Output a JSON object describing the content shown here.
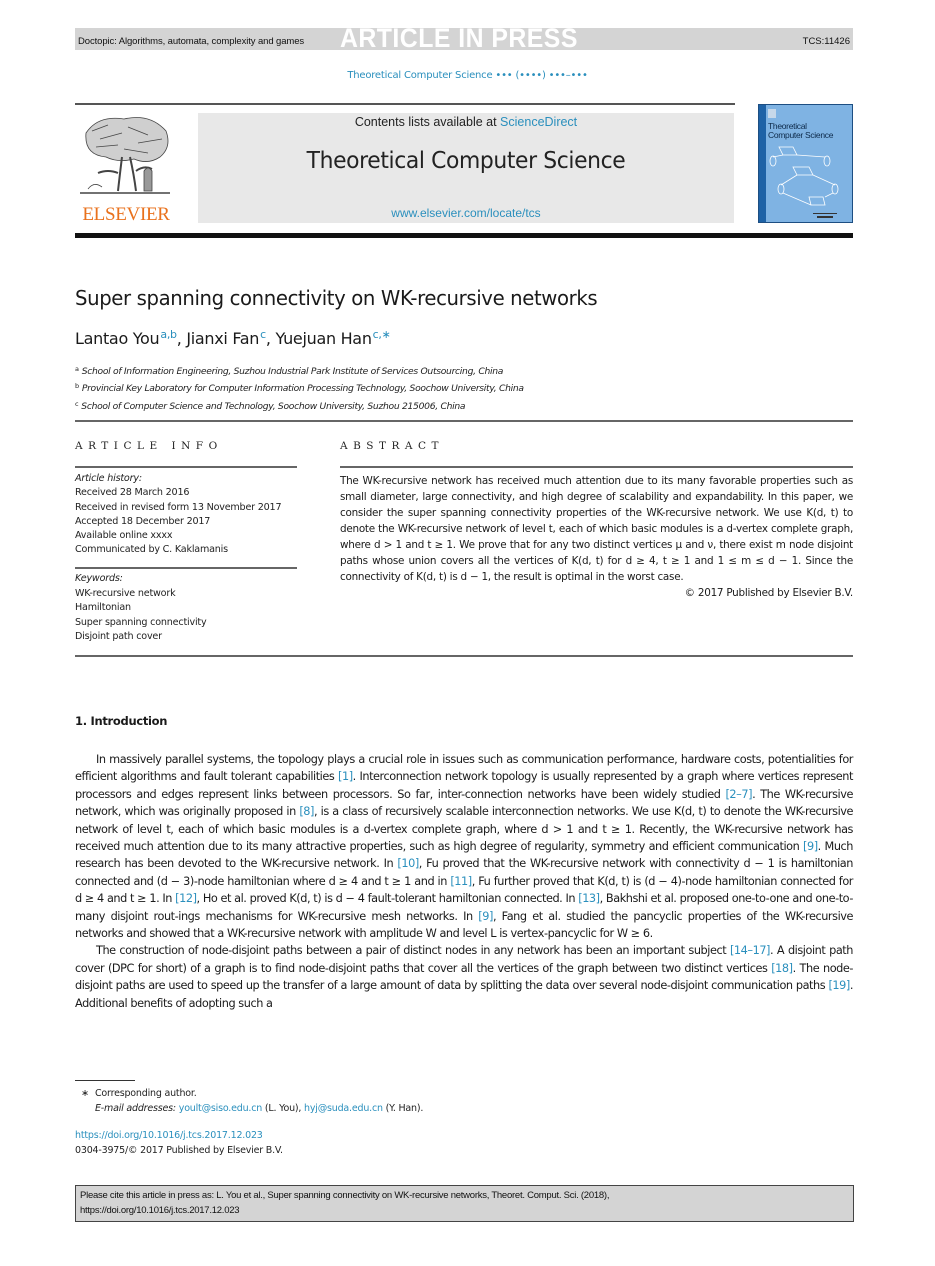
{
  "topbar": {
    "doctopic": "Doctopic: Algorithms, automata, complexity and games",
    "status": "ARTICLE IN PRESS",
    "article_code": "TCS:11426"
  },
  "journal_citation": "Theoretical Computer Science ••• (••••) •••–•••",
  "masthead": {
    "publisher_logo": "ELSEVIER",
    "contents_prefix": "Contents lists available at ",
    "contents_link": "ScienceDirect",
    "journal_title": "Theoretical Computer Science",
    "journal_url": "www.elsevier.com/locate/tcs",
    "cover_title_line1": "Theoretical",
    "cover_title_line2": "Computer Science"
  },
  "article": {
    "title": "Super spanning connectivity on WK-recursive networks",
    "authors": [
      {
        "name": "Lantao You",
        "affil": "a,b"
      },
      {
        "name": "Jianxi Fan",
        "affil": "c"
      },
      {
        "name": "Yuejuan Han",
        "affil": "c,∗"
      }
    ],
    "affiliations": [
      {
        "mark": "a",
        "text": "School of Information Engineering, Suzhou Industrial Park Institute of Services Outsourcing, China"
      },
      {
        "mark": "b",
        "text": "Provincial Key Laboratory for Computer Information Processing Technology, Soochow University, China"
      },
      {
        "mark": "c",
        "text": "School of Computer Science and Technology, Soochow University, Suzhou 215006, China"
      }
    ]
  },
  "article_info": {
    "heading": "ARTICLE INFO",
    "history_label": "Article history:",
    "history": [
      "Received 28 March 2016",
      "Received in revised form 13 November 2017",
      "Accepted 18 December 2017",
      "Available online xxxx",
      "Communicated by C. Kaklamanis"
    ],
    "keywords_label": "Keywords:",
    "keywords": [
      "WK-recursive network",
      "Hamiltonian",
      "Super spanning connectivity",
      "Disjoint path cover"
    ]
  },
  "abstract": {
    "heading": "ABSTRACT",
    "text": "The WK-recursive network has received much attention due to its many favorable properties such as small diameter, large connectivity, and high degree of scalability and expandability. In this paper, we consider the super spanning connectivity properties of the WK-recursive network. We use K(d, t) to denote the WK-recursive network of level t, each of which basic modules is a d-vertex complete graph, where d > 1 and t ≥ 1. We prove that for any two distinct vertices μ and ν, there exist m node disjoint paths whose union covers all the vertices of K(d, t) for d ≥ 4, t ≥ 1 and 1 ≤ m ≤ d − 1. Since the connectivity of K(d, t) is d − 1, the result is optimal in the worst case.",
    "copyright": "© 2017 Published by Elsevier B.V."
  },
  "introduction": {
    "heading": "1. Introduction",
    "paragraphs": [
      [
        {
          "t": "In massively parallel systems, the topology plays a crucial role in issues such as communication performance, hardware costs, potentialities for efficient algorithms and fault tolerant capabilities "
        },
        {
          "ref": "[1]"
        },
        {
          "t": ". Interconnection network topology is usually represented by a graph where vertices represent processors and edges represent links between processors. So far, inter-connection networks have been widely studied "
        },
        {
          "ref": "[2–7]"
        },
        {
          "t": ". The WK-recursive network, which was originally proposed in "
        },
        {
          "ref": "[8]"
        },
        {
          "t": ", is a class of recursively scalable interconnection networks. We use K(d, t) to denote the WK-recursive network of level t, each of which basic modules is a d-vertex complete graph, where d > 1 and t ≥ 1. Recently, the WK-recursive network has received much attention due to its many attractive properties, such as high degree of regularity, symmetry and efficient communication "
        },
        {
          "ref": "[9]"
        },
        {
          "t": ". Much research has been devoted to the WK-recursive network. In "
        },
        {
          "ref": "[10]"
        },
        {
          "t": ", Fu proved that the WK-recursive network with connectivity d − 1 is hamiltonian connected and (d − 3)-node hamiltonian where d ≥ 4 and t ≥ 1 and in "
        },
        {
          "ref": "[11]"
        },
        {
          "t": ", Fu further proved that K(d, t) is (d − 4)-node hamiltonian connected for d ≥ 4 and t ≥ 1. In "
        },
        {
          "ref": "[12]"
        },
        {
          "t": ", Ho et al. proved K(d, t) is d − 4 fault-tolerant hamiltonian connected. In "
        },
        {
          "ref": "[13]"
        },
        {
          "t": ", Bakhshi et al. proposed one-to-one and one-to-many disjoint rout-ings mechanisms for WK-recursive mesh networks. In "
        },
        {
          "ref": "[9]"
        },
        {
          "t": ", Fang et al. studied the pancyclic properties of the WK-recursive networks and showed that a WK-recursive network with amplitude W and level L is vertex-pancyclic for W ≥ 6."
        }
      ],
      [
        {
          "t": "The construction of node-disjoint paths between a pair of distinct nodes in any network has been an important subject "
        },
        {
          "ref": "[14–17]"
        },
        {
          "t": ". A disjoint path cover (DPC for short) of a graph is to find node-disjoint paths that cover all the vertices of the graph between two distinct vertices "
        },
        {
          "ref": "[18]"
        },
        {
          "t": ". The node-disjoint paths are used to speed up the transfer of a large amount of data by splitting the data over several node-disjoint communication paths "
        },
        {
          "ref": "[19]"
        },
        {
          "t": ". Additional benefits of adopting such a"
        }
      ]
    ]
  },
  "footnotes": {
    "star": "∗",
    "corresponding": "Corresponding author.",
    "email_label": "E-mail addresses: ",
    "email1": "yoult@siso.edu.cn",
    "email1_owner": " (L. You), ",
    "email2": "hyj@suda.edu.cn",
    "email2_owner": " (Y. Han).",
    "doi_link": "https://doi.org/10.1016/j.tcs.2017.12.023",
    "issn_line": "0304-3975/© 2017 Published by Elsevier B.V."
  },
  "citation_box": {
    "line1": "Please cite this article in press as: L. You et al., Super spanning connectivity on WK-recursive networks, Theoret. Comput. Sci. (2018),",
    "line2": "https://doi.org/10.1016/j.tcs.2017.12.023"
  },
  "colors": {
    "link": "#2a8fbd",
    "elsevier_orange": "#e9711c",
    "topbar_gray": "#d4d4d4",
    "banner_gray": "#e8e8e8",
    "cover_blue": "#7fb3e3"
  }
}
